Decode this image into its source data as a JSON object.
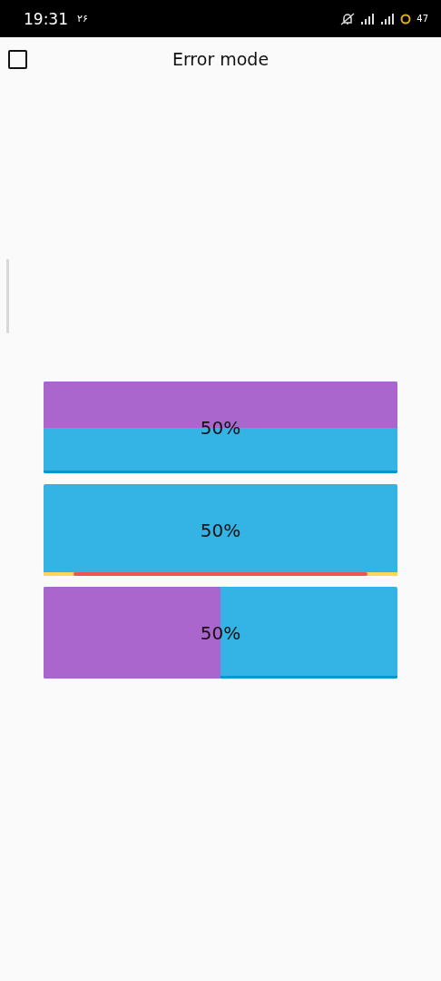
{
  "status_bar": {
    "time": "19:31",
    "date": "۲۶",
    "battery": "47"
  },
  "toolbar": {
    "checkbox": {
      "checked": false
    },
    "title": "Error mode"
  },
  "progress_boxes": [
    {
      "kind": "vertical",
      "label": "50%"
    },
    {
      "kind": "error",
      "label": "50%"
    },
    {
      "kind": "horizontal",
      "level": 0.5,
      "label": "50%"
    }
  ]
}
